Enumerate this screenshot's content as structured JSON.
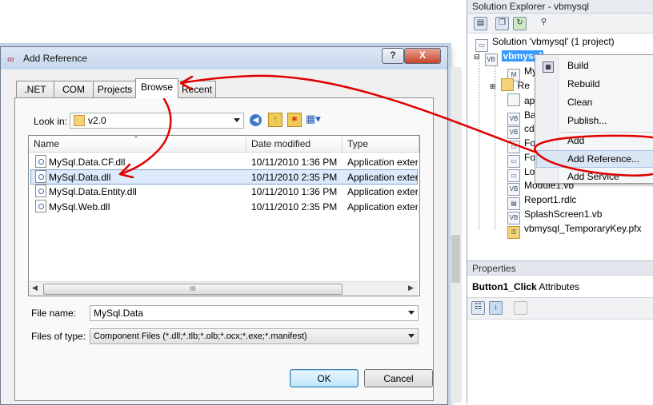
{
  "solution_explorer": {
    "title": "Solution Explorer - vbmysql",
    "solution_label": "Solution 'vbmysql' (1 project)",
    "project": "vbmysql",
    "items": [
      "My",
      "Re",
      "ap",
      "Ba",
      "cd",
      "Fo",
      "Fo",
      "Lo",
      "Module1.vb",
      "Report1.rdlc",
      "SplashScreen1.vb",
      "vbmysql_TemporaryKey.pfx"
    ],
    "toolbar_icons": [
      "properties-icon",
      "show-all-files-icon",
      "refresh-icon",
      "class-diagram-icon"
    ]
  },
  "properties": {
    "title": "Properties",
    "object": "Button1_Click",
    "object_type": "Attributes"
  },
  "context_menu": {
    "items": [
      "Build",
      "Rebuild",
      "Clean",
      "Publish...",
      "Add",
      "Add Reference...",
      "Add Service Reference..."
    ]
  },
  "dialog": {
    "title": "Add Reference",
    "help_btn": "?",
    "close_btn": "X",
    "tabs": [
      ".NET",
      "COM",
      "Projects",
      "Browse",
      "Recent"
    ],
    "selected_tab": "Browse",
    "look_in_label": "Look in:",
    "look_in_value": "v2.0",
    "columns": [
      "Name",
      "Date modified",
      "Type"
    ],
    "files": [
      {
        "name": "MySql.Data.CF.dll",
        "date": "10/11/2010 1:36 PM",
        "type": "Application exter"
      },
      {
        "name": "MySql.Data.dll",
        "date": "10/11/2010 2:35 PM",
        "type": "Application exter"
      },
      {
        "name": "MySql.Data.Entity.dll",
        "date": "10/11/2010 1:36 PM",
        "type": "Application exter"
      },
      {
        "name": "MySql.Web.dll",
        "date": "10/11/2010 2:35 PM",
        "type": "Application exter"
      }
    ],
    "selected_file": "MySql.Data.dll",
    "file_name_label": "File name:",
    "file_name_value": "MySql.Data",
    "files_of_type_label": "Files of type:",
    "files_of_type_value": "Component Files (*.dll;*.tlb;*.olb;*.ocx;*.exe;*.manifest)",
    "ok": "OK",
    "cancel": "Cancel",
    "scroll_grip": "III"
  },
  "annotation_color": "#e00000"
}
